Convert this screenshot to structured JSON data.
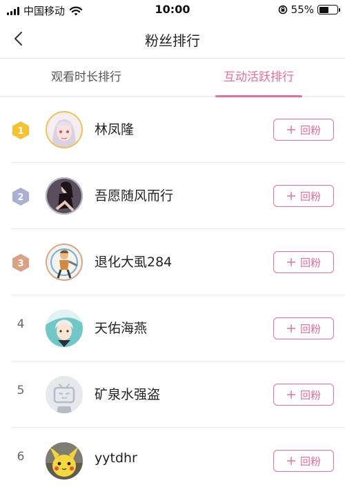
{
  "status_bar": {
    "carrier": "中国移动",
    "time": "10:00",
    "battery_percent": "55%",
    "battery_level": 0.55
  },
  "nav": {
    "title": "粉丝排行",
    "back_icon": "chevron-left-icon"
  },
  "tabs": [
    {
      "label": "观看时长排行",
      "active": false
    },
    {
      "label": "互动活跃排行",
      "active": true
    }
  ],
  "accent_color": "#e96d94",
  "fans": [
    {
      "rank": "1",
      "badge": "gold",
      "name": "林凤隆",
      "button": "回粉"
    },
    {
      "rank": "2",
      "badge": "silver",
      "name": "吾愿随风而行",
      "button": "回粉"
    },
    {
      "rank": "3",
      "badge": "bronze",
      "name": "退化大虱284",
      "button": "回粉"
    },
    {
      "rank": "4",
      "badge": "none",
      "name": "天佑海燕",
      "button": "回粉"
    },
    {
      "rank": "5",
      "badge": "none",
      "name": "矿泉水强盗",
      "button": "回粉"
    },
    {
      "rank": "6",
      "badge": "none",
      "name": "yytdhr",
      "button": "回粉"
    }
  ]
}
